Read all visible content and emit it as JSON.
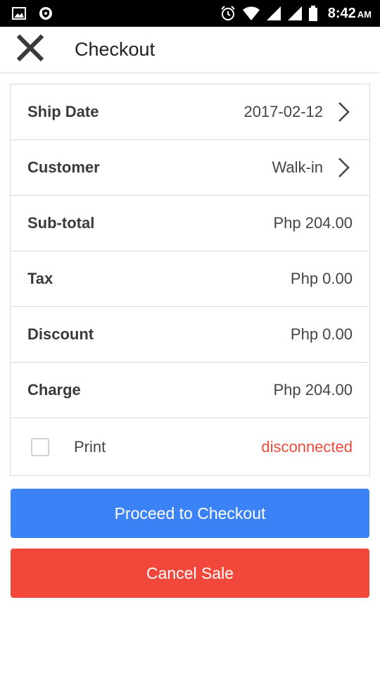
{
  "status_bar": {
    "time": "8:42",
    "ampm": "AM",
    "icons": [
      "image-icon",
      "vpn-shield-icon",
      "alarm-icon",
      "wifi-icon",
      "signal-icon",
      "signal-icon",
      "battery-icon"
    ]
  },
  "toolbar": {
    "title": "Checkout",
    "close_icon": "close-icon"
  },
  "rows": {
    "ship_date": {
      "label": "Ship Date",
      "value": "2017-02-12"
    },
    "customer": {
      "label": "Customer",
      "value": "Walk-in"
    },
    "subtotal": {
      "label": "Sub-total",
      "value": "Php 204.00"
    },
    "tax": {
      "label": "Tax",
      "value": "Php 0.00"
    },
    "discount": {
      "label": "Discount",
      "value": "Php 0.00"
    },
    "charge": {
      "label": "Charge",
      "value": "Php 204.00"
    }
  },
  "print": {
    "label": "Print",
    "checked": false,
    "status": "disconnected"
  },
  "buttons": {
    "proceed": "Proceed to Checkout",
    "cancel": "Cancel Sale"
  },
  "colors": {
    "primary": "#3b82f6",
    "danger": "#f1483b",
    "status_error": "#ef4a3c"
  }
}
